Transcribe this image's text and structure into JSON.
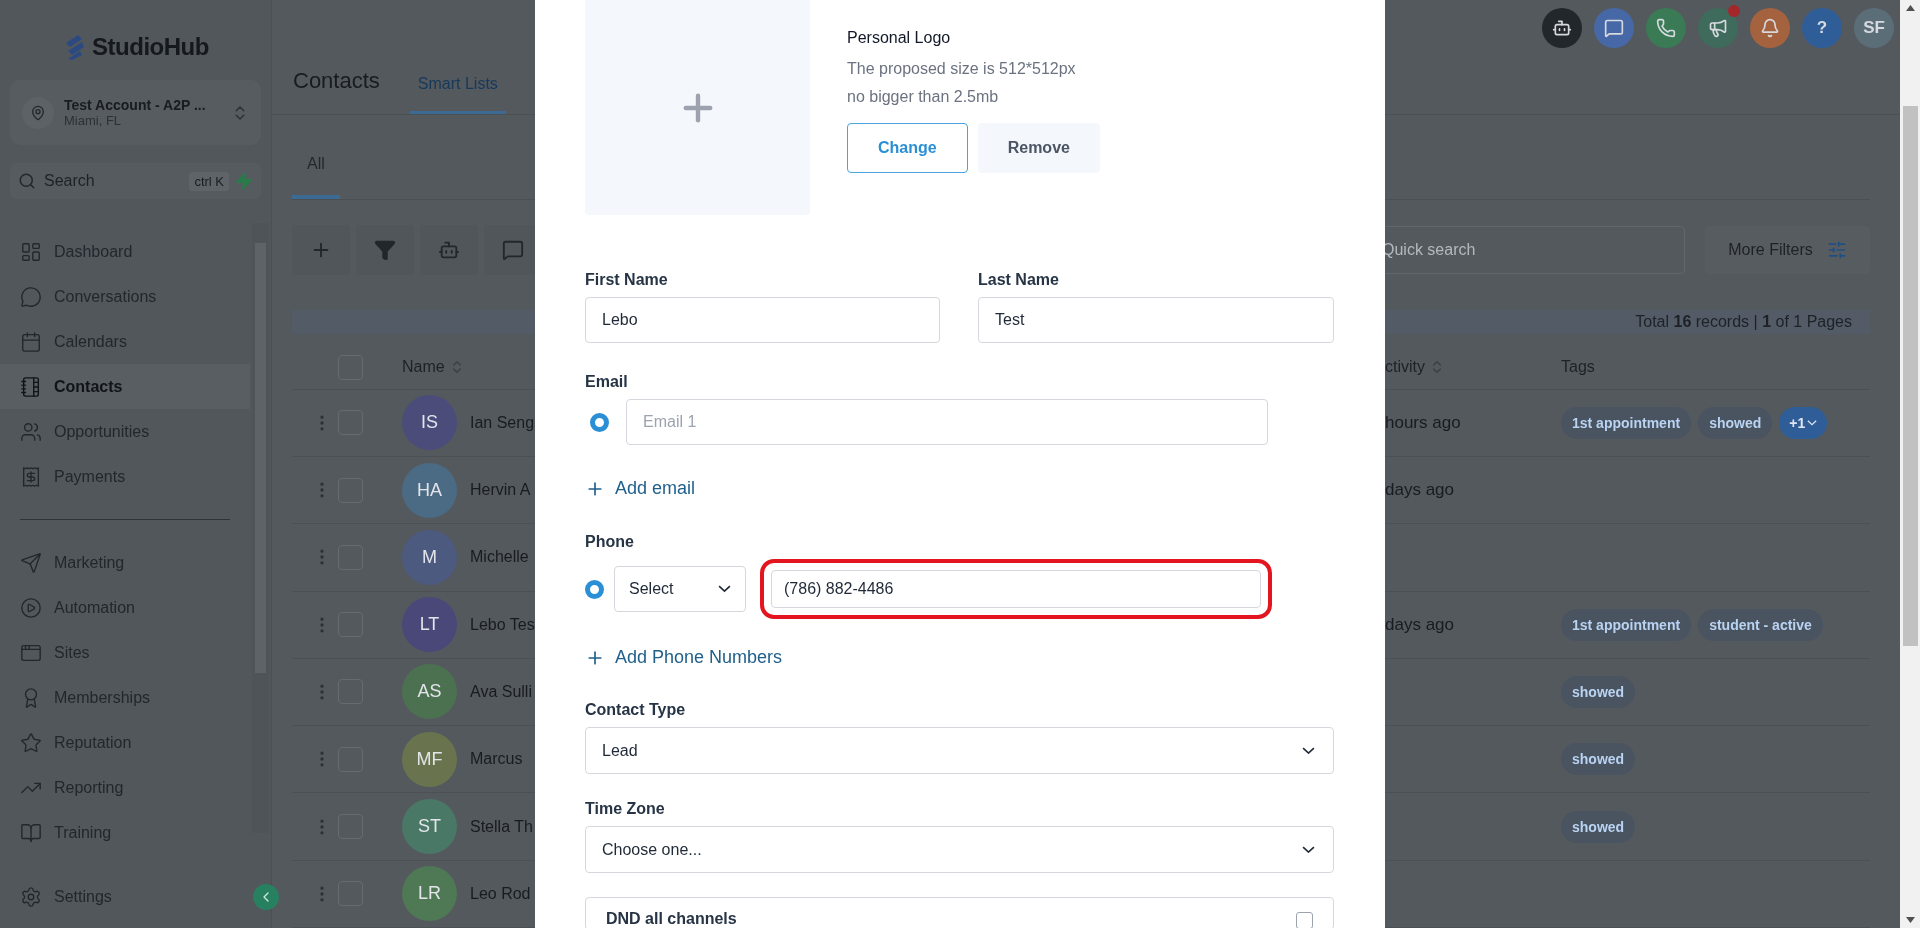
{
  "app": {
    "logo": "StudioHub"
  },
  "account": {
    "name": "Test Account - A2P ...",
    "location": "Miami, FL"
  },
  "search": {
    "placeholder": "Search",
    "shortcut": "ctrl K"
  },
  "sidebar": {
    "primary": [
      {
        "label": "Dashboard",
        "kind": "dashboard",
        "selected": false
      },
      {
        "label": "Conversations",
        "kind": "chat",
        "selected": false
      },
      {
        "label": "Calendars",
        "kind": "calendar",
        "selected": false
      },
      {
        "label": "Contacts",
        "kind": "contacts",
        "selected": true
      },
      {
        "label": "Opportunities",
        "kind": "people",
        "selected": false
      },
      {
        "label": "Payments",
        "kind": "payments",
        "selected": false
      }
    ],
    "secondary": [
      {
        "label": "Marketing",
        "kind": "send",
        "selected": false
      },
      {
        "label": "Automation",
        "kind": "play",
        "selected": false
      },
      {
        "label": "Sites",
        "kind": "site",
        "selected": false
      },
      {
        "label": "Memberships",
        "kind": "award",
        "selected": false
      },
      {
        "label": "Reputation",
        "kind": "star",
        "selected": false
      },
      {
        "label": "Reporting",
        "kind": "trend",
        "selected": false
      },
      {
        "label": "Training",
        "kind": "book",
        "selected": false
      }
    ],
    "footer": {
      "label": "Settings"
    }
  },
  "header": {
    "actions": [
      {
        "kind": "bot",
        "color": "#22272c",
        "notification": false
      },
      {
        "kind": "chat",
        "color": "#4768a6",
        "notification": false
      },
      {
        "kind": "phone",
        "color": "#3a7a55",
        "notification": false
      },
      {
        "kind": "megaphone",
        "color": "#3e6b5c",
        "notification": true
      },
      {
        "kind": "bell",
        "color": "#a5623e",
        "notification": false
      },
      {
        "kind": "help",
        "text": "?",
        "color": "#2f5d98",
        "notification": false
      },
      {
        "kind": "avatar",
        "text": "SF",
        "color": "#5b6e78",
        "notification": false
      }
    ],
    "title": "Contacts",
    "tabs": [
      {
        "label": "Smart Lists",
        "selected": true
      }
    ]
  },
  "subtabs": [
    {
      "label": "All",
      "selected": true
    }
  ],
  "toolbar": {
    "buttons": [
      {
        "kind": "plus"
      },
      {
        "kind": "filter"
      },
      {
        "kind": "bot"
      },
      {
        "kind": "message"
      }
    ],
    "quick_search": {
      "placeholder": "Quick search"
    },
    "more_filters": "More Filters"
  },
  "table": {
    "summary": "Total **16** records | **1** of 1 Pages",
    "all_checked": false,
    "columns": [
      "Name",
      "ctivity",
      "Tags"
    ],
    "rows": [
      {
        "initials": "IS",
        "color": "#4b4c7a",
        "checked": false,
        "name": "Ian Seng",
        "activity": "hours ago",
        "tags": [
          "1st appointment",
          "showed"
        ],
        "more": "+1"
      },
      {
        "initials": "HA",
        "color": "#4b6a84",
        "checked": false,
        "name": "Hervin A",
        "activity": "days ago"
      },
      {
        "initials": "M",
        "color": "#4d5a80",
        "checked": false,
        "name": "Michelle"
      },
      {
        "initials": "LT",
        "color": "#4a4879",
        "checked": false,
        "name": "Lebo Tes",
        "activity": "days ago",
        "tags": [
          "1st appointment",
          "student - active"
        ]
      },
      {
        "initials": "AS",
        "color": "#4c7150",
        "checked": false,
        "name": "Ava Sulli",
        "tags": [
          "showed"
        ]
      },
      {
        "initials": "MF",
        "color": "#69744f",
        "checked": false,
        "name": "Marcus",
        "tags": [
          "showed"
        ]
      },
      {
        "initials": "ST",
        "color": "#4a7866",
        "checked": false,
        "name": "Stella Th",
        "tags": [
          "showed"
        ]
      },
      {
        "initials": "LR",
        "color": "#4f7855",
        "checked": false,
        "name": "Leo Rod"
      }
    ]
  },
  "modal": {
    "logo": {
      "title": "Personal Logo",
      "hints": [
        "The proposed size is 512*512px",
        "no bigger than 2.5mb"
      ],
      "buttons": [
        {
          "label": "Change",
          "kind": "outline"
        },
        {
          "label": "Remove",
          "kind": "plain"
        }
      ]
    },
    "first_name": {
      "label": "First Name",
      "value": "Lebo"
    },
    "last_name": {
      "label": "Last Name",
      "value": "Test"
    },
    "email": {
      "label": "Email",
      "entries": [
        {
          "placeholder": "Email 1",
          "selected": true
        }
      ],
      "add_label": "Add email"
    },
    "phone": {
      "label": "Phone",
      "entries": [
        {
          "type_value": "Select",
          "value": "(786) 882-4486",
          "selected": true,
          "highlighted": true
        }
      ],
      "add_label": "Add Phone Numbers"
    },
    "contact_type": {
      "label": "Contact Type",
      "value": "Lead"
    },
    "time_zone": {
      "label": "Time Zone",
      "value": "Choose one..."
    },
    "dnd": {
      "label": "DND all channels",
      "checked": false
    }
  }
}
